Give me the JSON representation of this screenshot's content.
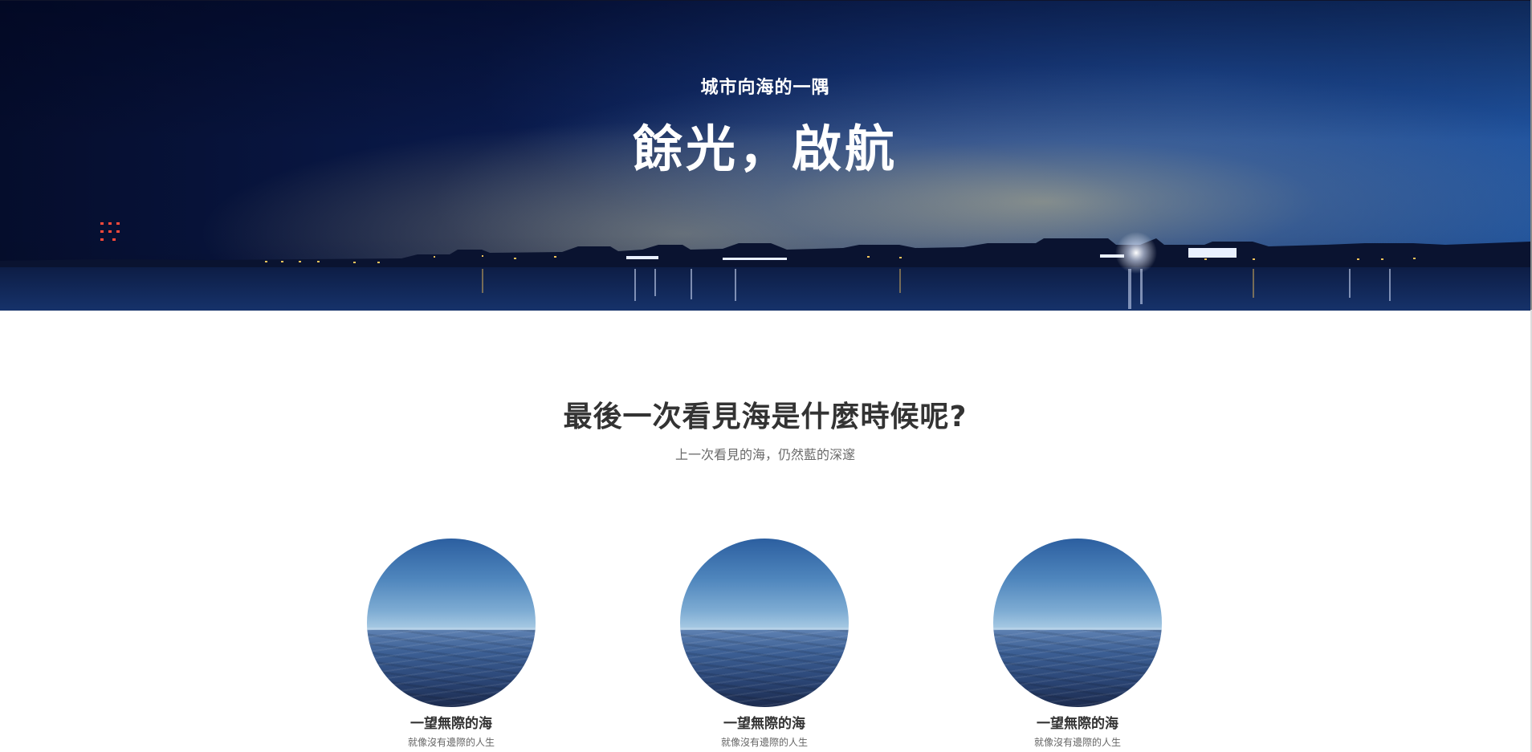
{
  "hero": {
    "subtitle": "城市向海的一隅",
    "title": "餘光，啟航"
  },
  "section": {
    "title": "最後一次看見海是什麼時候呢?",
    "lead": "上一次看見的海，仍然藍的深邃"
  },
  "cards": [
    {
      "title": "一望無際的海",
      "text": "就像沒有邊際的人生"
    },
    {
      "title": "一望無際的海",
      "text": "就像沒有邊際的人生"
    },
    {
      "title": "一望無際的海",
      "text": "就像沒有邊際的人生"
    }
  ],
  "colors": {
    "hero_dark": "#050d2c",
    "hero_blue": "#103b82",
    "heading": "#333333",
    "muted": "#6a6a6a"
  }
}
